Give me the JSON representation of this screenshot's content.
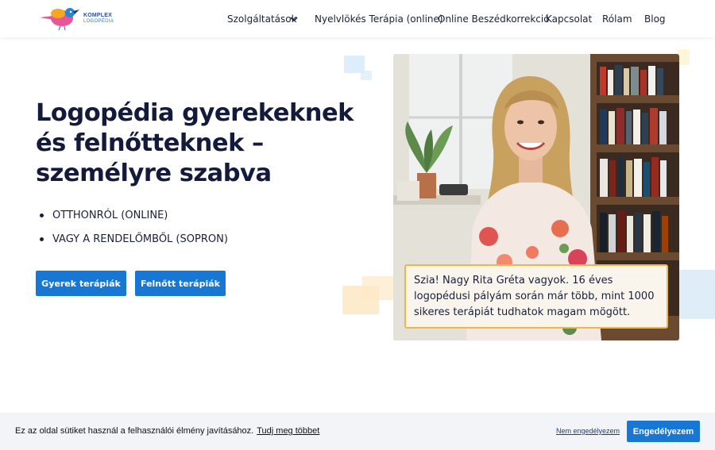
{
  "header": {
    "logo": {
      "line1": "KOMPLEX",
      "line2": "LOGOPÉDIA",
      "colors": {
        "pink": "#e8559a",
        "orange": "#f5a623",
        "blue": "#2a86c9"
      }
    },
    "nav": [
      {
        "label": "Szolgáltatások",
        "has_dropdown": true
      },
      {
        "label": "Nyelvlökés Terápia (online)"
      },
      {
        "label": "Online Beszédkorrekció"
      },
      {
        "label": "Kapcsolat"
      },
      {
        "label": "Rólam"
      },
      {
        "label": "Blog"
      }
    ]
  },
  "hero": {
    "title": "Logopédia gyerekeknek és felnőtteknek – személyre szabva",
    "bullets": [
      "OTTHONRÓL (ONLINE)",
      "VAGY A RENDELŐMBŐL (SOPRON)"
    ],
    "buttons": {
      "children": "Gyerek terápiák",
      "adults": "Felnőtt terápiák"
    },
    "caption": "Szia! Nagy Rita Gréta vagyok. 16 éves logopédusi pályám során már több, mint 1000 sikeres terápiát tudhatok magam mögött."
  },
  "cookie": {
    "message": "Ez az oldal sütiket használ a felhasználói élmény javításához.",
    "learn_more": "Tudj meg többet",
    "deny": "Nem engedélyezem",
    "allow": "Engedélyezem"
  },
  "colors": {
    "accent": "#1877d2",
    "caption_border": "#f0b64a",
    "text": "#141a3b"
  }
}
